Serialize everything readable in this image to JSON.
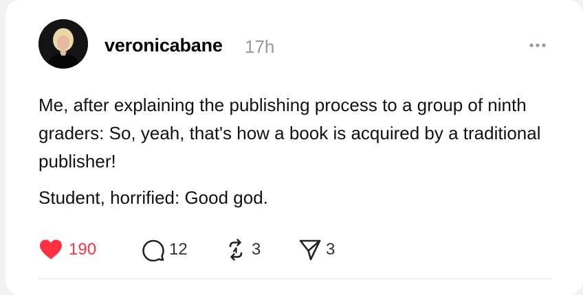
{
  "post": {
    "username": "veronicabane",
    "timestamp": "17h",
    "paragraphs": [
      "Me, after explaining the publishing process to a group of ninth graders: So, yeah, that's how a book is acquired by a traditional publisher!",
      "Student, horrified: Good god."
    ],
    "actions": {
      "likes": "190",
      "replies": "12",
      "reposts": "3",
      "shares": "3"
    },
    "liked": true,
    "like_color": "#ff3040"
  },
  "icons": {
    "more": "more-horizontal-icon",
    "like": "heart-icon",
    "reply": "comment-bubble-icon",
    "repost": "repost-icon",
    "share": "send-icon"
  }
}
